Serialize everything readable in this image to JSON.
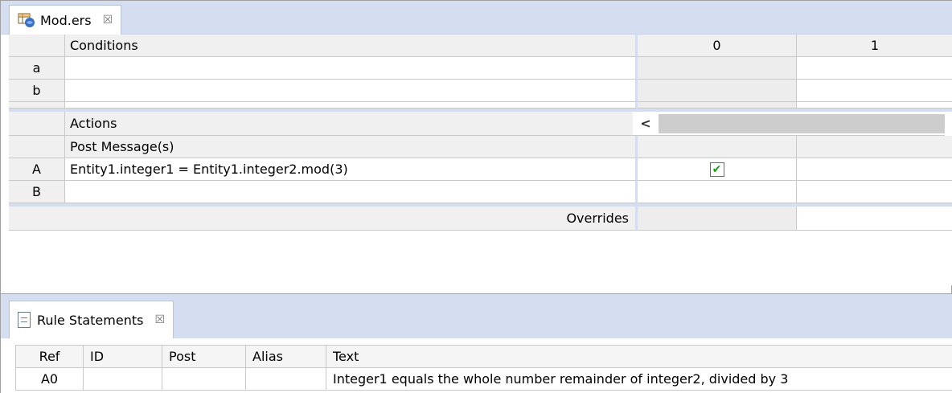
{
  "editor": {
    "tab_title": "Mod.ers",
    "close_glyph": "☒",
    "icon": "table-editor-icon"
  },
  "conditions": {
    "header": "Conditions",
    "col0": "0",
    "col1": "1",
    "rows": [
      {
        "id": "a",
        "text": ""
      },
      {
        "id": "b",
        "text": ""
      }
    ]
  },
  "actions": {
    "header": "Actions",
    "scroll_left": "<",
    "post_messages": "Post Message(s)",
    "rows": [
      {
        "id": "A",
        "text": "Entity1.integer1 = Entity1.integer2.mod(3)",
        "col0_checked": true
      },
      {
        "id": "B",
        "text": "",
        "col0_checked": false
      }
    ],
    "overrides": "Overrides"
  },
  "rule_statements": {
    "tab_title": "Rule Statements",
    "close_glyph": "☒",
    "columns": [
      "Ref",
      "ID",
      "Post",
      "Alias",
      "Text"
    ],
    "rows": [
      {
        "ref": "A0",
        "id": "",
        "post": "",
        "alias": "",
        "text": "Integer1 equals the whole number remainder of integer2, divided by 3"
      }
    ]
  },
  "colors": {
    "tab_strip": "#d4def0",
    "grid_line": "#c9c9c9",
    "check_green": "#1a9c1a"
  }
}
